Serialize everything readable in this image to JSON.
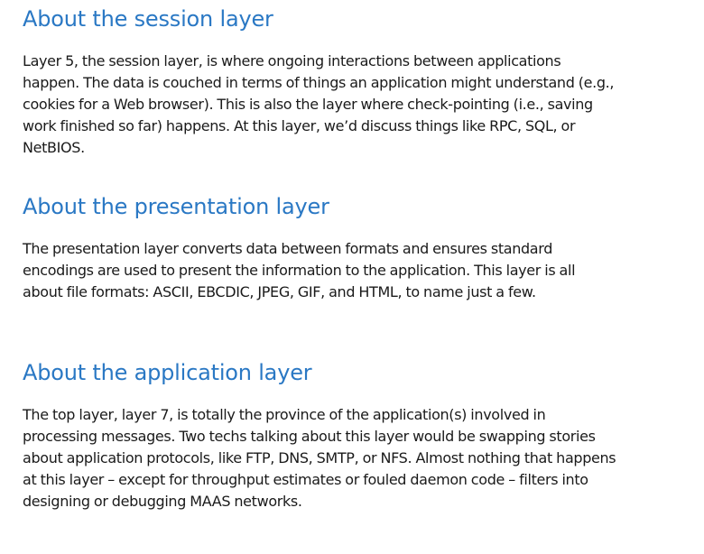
{
  "sections": [
    {
      "title": "About the session layer",
      "body": "Layer 5, the session layer, is where ongoing interactions between applications happen. The data is couched in terms of things an application might understand (e.g., cookies for a Web browser). This is also the layer where check-pointing (i.e., saving work finished so far) happens. At this layer, we’d discuss things like RPC, SQL, or NetBIOS."
    },
    {
      "title": "About the presentation layer",
      "body": "The presentation layer converts data between formats and ensures standard encodings are used to present the information to the application. This layer is all about file formats: ASCII, EBCDIC, JPEG, GIF, and HTML, to name just a few."
    },
    {
      "title": "About the application layer",
      "body": "The top layer, layer 7, is totally the province of the application(s) involved in processing messages. Two techs talking about this layer would be swapping stories about application protocols, like FTP, DNS, SMTP, or NFS. Almost nothing that happens at this layer – except for throughput estimates or fouled daemon code – filters into designing or debugging MAAS networks."
    }
  ],
  "colors": {
    "heading": "#2a78c4",
    "text": "#1a1a1a",
    "background": "#ffffff"
  }
}
